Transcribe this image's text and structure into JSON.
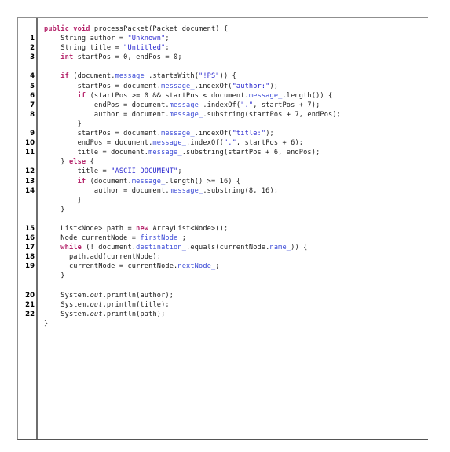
{
  "viewer": {
    "name": "java-source-code-viewer",
    "language": "Java",
    "colors": {
      "background": "#ffffff",
      "plain_text": "#1a1a1a",
      "keyword": "#b5256b",
      "string": "#2a28cf",
      "field": "#3a49d6",
      "gutter_rule": "#6e6e6e",
      "border": "#8f8f8f"
    }
  },
  "gutter": {
    "name": "line-number-gutter",
    "numbers": [
      "",
      "1",
      "2",
      "3",
      "",
      "4",
      "5",
      "6",
      "7",
      "8",
      "",
      "9",
      "10",
      "11",
      "",
      "12",
      "13",
      "14",
      "",
      "",
      "",
      "15",
      "16",
      "17",
      "18",
      "19",
      "",
      "",
      "20",
      "21",
      "22",
      ""
    ]
  },
  "code": {
    "lines": [
      {
        "n": "",
        "tokens": [
          {
            "t": "kw",
            "v": "public void"
          },
          {
            "t": "pl",
            "v": " processPacket(Packet document) {"
          }
        ]
      },
      {
        "n": "1",
        "tokens": [
          {
            "t": "pl",
            "v": "    String author = "
          },
          {
            "t": "str",
            "v": "\"Unknown\""
          },
          {
            "t": "pl",
            "v": ";"
          }
        ]
      },
      {
        "n": "2",
        "tokens": [
          {
            "t": "pl",
            "v": "    String title = "
          },
          {
            "t": "str",
            "v": "\"Untitled\""
          },
          {
            "t": "pl",
            "v": ";"
          }
        ]
      },
      {
        "n": "3",
        "tokens": [
          {
            "t": "pl",
            "v": "    "
          },
          {
            "t": "kw",
            "v": "int"
          },
          {
            "t": "pl",
            "v": " startPos = 0, endPos = 0;"
          }
        ]
      },
      {
        "n": "",
        "tokens": [
          {
            "t": "pl",
            "v": ""
          }
        ]
      },
      {
        "n": "4",
        "tokens": [
          {
            "t": "pl",
            "v": "    "
          },
          {
            "t": "kw",
            "v": "if"
          },
          {
            "t": "pl",
            "v": " (document."
          },
          {
            "t": "fld",
            "v": "message_"
          },
          {
            "t": "pl",
            "v": ".startsWith("
          },
          {
            "t": "str",
            "v": "\"!PS\""
          },
          {
            "t": "pl",
            "v": ")) {"
          }
        ]
      },
      {
        "n": "5",
        "tokens": [
          {
            "t": "pl",
            "v": "        startPos = document."
          },
          {
            "t": "fld",
            "v": "message_"
          },
          {
            "t": "pl",
            "v": ".indexOf("
          },
          {
            "t": "str",
            "v": "\"author:\""
          },
          {
            "t": "pl",
            "v": ");"
          }
        ]
      },
      {
        "n": "6",
        "tokens": [
          {
            "t": "pl",
            "v": "        "
          },
          {
            "t": "kw",
            "v": "if"
          },
          {
            "t": "pl",
            "v": " (startPos >= 0 && startPos < document."
          },
          {
            "t": "fld",
            "v": "message_"
          },
          {
            "t": "pl",
            "v": ".length()) {"
          }
        ]
      },
      {
        "n": "7",
        "tokens": [
          {
            "t": "pl",
            "v": "            endPos = document."
          },
          {
            "t": "fld",
            "v": "message_"
          },
          {
            "t": "pl",
            "v": ".indexOf("
          },
          {
            "t": "str",
            "v": "\".\""
          },
          {
            "t": "pl",
            "v": ", startPos + 7);"
          }
        ]
      },
      {
        "n": "8",
        "tokens": [
          {
            "t": "pl",
            "v": "            author = document."
          },
          {
            "t": "fld",
            "v": "message_"
          },
          {
            "t": "pl",
            "v": ".substring(startPos + 7, endPos);"
          }
        ]
      },
      {
        "n": "",
        "tokens": [
          {
            "t": "pl",
            "v": "        }"
          }
        ]
      },
      {
        "n": "9",
        "tokens": [
          {
            "t": "pl",
            "v": "        startPos = document."
          },
          {
            "t": "fld",
            "v": "message_"
          },
          {
            "t": "pl",
            "v": ".indexOf("
          },
          {
            "t": "str",
            "v": "\"title:\""
          },
          {
            "t": "pl",
            "v": ");"
          }
        ]
      },
      {
        "n": "10",
        "tokens": [
          {
            "t": "pl",
            "v": "        endPos = document."
          },
          {
            "t": "fld",
            "v": "message_"
          },
          {
            "t": "pl",
            "v": ".indexOf("
          },
          {
            "t": "str",
            "v": "\".\""
          },
          {
            "t": "pl",
            "v": ", startPos + 6);"
          }
        ]
      },
      {
        "n": "11",
        "tokens": [
          {
            "t": "pl",
            "v": "        title = document."
          },
          {
            "t": "fld",
            "v": "message_"
          },
          {
            "t": "pl",
            "v": ".substring(startPos + 6, endPos);"
          }
        ]
      },
      {
        "n": "",
        "tokens": [
          {
            "t": "pl",
            "v": "    } "
          },
          {
            "t": "kw",
            "v": "else"
          },
          {
            "t": "pl",
            "v": " {"
          }
        ]
      },
      {
        "n": "12",
        "tokens": [
          {
            "t": "pl",
            "v": "        title = "
          },
          {
            "t": "str",
            "v": "\"ASCII DOCUMENT\""
          },
          {
            "t": "pl",
            "v": ";"
          }
        ]
      },
      {
        "n": "13",
        "tokens": [
          {
            "t": "pl",
            "v": "        "
          },
          {
            "t": "kw",
            "v": "if"
          },
          {
            "t": "pl",
            "v": " (document."
          },
          {
            "t": "fld",
            "v": "message_"
          },
          {
            "t": "pl",
            "v": ".length() >= 16) {"
          }
        ]
      },
      {
        "n": "14",
        "tokens": [
          {
            "t": "pl",
            "v": "            author = document."
          },
          {
            "t": "fld",
            "v": "message_"
          },
          {
            "t": "pl",
            "v": ".substring(8, 16);"
          }
        ]
      },
      {
        "n": "",
        "tokens": [
          {
            "t": "pl",
            "v": "        }"
          }
        ]
      },
      {
        "n": "",
        "tokens": [
          {
            "t": "pl",
            "v": "    }"
          }
        ]
      },
      {
        "n": "",
        "tokens": [
          {
            "t": "pl",
            "v": ""
          }
        ]
      },
      {
        "n": "15",
        "tokens": [
          {
            "t": "pl",
            "v": "    List<Node> path = "
          },
          {
            "t": "kw",
            "v": "new"
          },
          {
            "t": "pl",
            "v": " ArrayList<Node>();"
          }
        ]
      },
      {
        "n": "16",
        "tokens": [
          {
            "t": "pl",
            "v": "    Node currentNode = "
          },
          {
            "t": "fld",
            "v": "firstNode_"
          },
          {
            "t": "pl",
            "v": ";"
          }
        ]
      },
      {
        "n": "17",
        "tokens": [
          {
            "t": "pl",
            "v": "    "
          },
          {
            "t": "kw",
            "v": "while"
          },
          {
            "t": "pl",
            "v": " (! document."
          },
          {
            "t": "fld",
            "v": "destination_"
          },
          {
            "t": "pl",
            "v": ".equals(currentNode."
          },
          {
            "t": "fld",
            "v": "name_"
          },
          {
            "t": "pl",
            "v": ")) {"
          }
        ]
      },
      {
        "n": "18",
        "tokens": [
          {
            "t": "pl",
            "v": "      path.add(currentNode);"
          }
        ]
      },
      {
        "n": "19",
        "tokens": [
          {
            "t": "pl",
            "v": "      currentNode = currentNode."
          },
          {
            "t": "fld",
            "v": "nextNode_"
          },
          {
            "t": "pl",
            "v": ";"
          }
        ]
      },
      {
        "n": "",
        "tokens": [
          {
            "t": "pl",
            "v": "    }"
          }
        ]
      },
      {
        "n": "",
        "tokens": [
          {
            "t": "pl",
            "v": ""
          }
        ]
      },
      {
        "n": "20",
        "tokens": [
          {
            "t": "pl",
            "v": "    System."
          },
          {
            "t": "em",
            "v": "out"
          },
          {
            "t": "pl",
            "v": ".println(author);"
          }
        ]
      },
      {
        "n": "21",
        "tokens": [
          {
            "t": "pl",
            "v": "    System."
          },
          {
            "t": "em",
            "v": "out"
          },
          {
            "t": "pl",
            "v": ".println(title);"
          }
        ]
      },
      {
        "n": "22",
        "tokens": [
          {
            "t": "pl",
            "v": "    System."
          },
          {
            "t": "em",
            "v": "out"
          },
          {
            "t": "pl",
            "v": ".println(path);"
          }
        ]
      },
      {
        "n": "",
        "tokens": [
          {
            "t": "pl",
            "v": "}"
          }
        ]
      }
    ]
  }
}
